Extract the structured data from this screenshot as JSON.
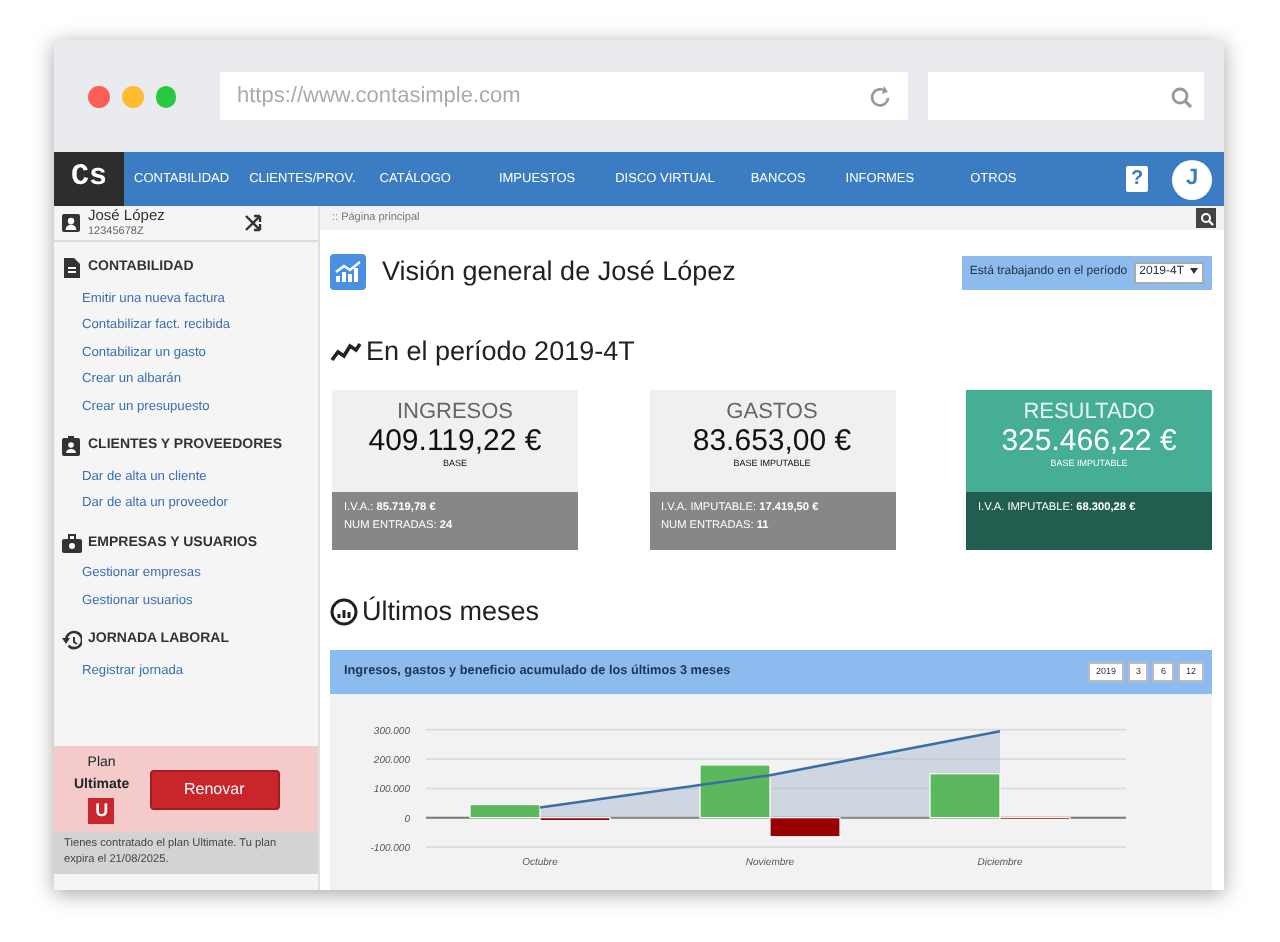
{
  "browser": {
    "url": "https://www.contasimple.com"
  },
  "navbar": {
    "logo": "Cs",
    "items": [
      "CONTABILIDAD",
      "CLIENTES/PROV.",
      "CATÁLOGO",
      "IMPUESTOS",
      "DISCO VIRTUAL",
      "BANCOS",
      "INFORMES",
      "OTROS"
    ],
    "help": "?",
    "avatar": "J"
  },
  "sidebar": {
    "user": {
      "name": "José López",
      "id": "12345678Z"
    },
    "sections": [
      {
        "title": "CONTABILIDAD",
        "links": [
          "Emitir una nueva factura",
          "Contabilizar fact. recibida",
          "Contabilizar un gasto",
          "Crear un albarán",
          "Crear un presupuesto"
        ]
      },
      {
        "title": "CLIENTES Y PROVEEDORES",
        "links": [
          "Dar de alta un cliente",
          "Dar de alta un proveedor"
        ]
      },
      {
        "title": "EMPRESAS Y USUARIOS",
        "links": [
          "Gestionar empresas",
          "Gestionar usuarios"
        ]
      },
      {
        "title": "JORNADA LABORAL",
        "links": [
          "Registrar jornada"
        ]
      }
    ],
    "plan": {
      "label": "Plan",
      "name": "Ultimate",
      "badge": "U",
      "button": "Renovar",
      "note": "Tienes contratado el plan Ultimate. Tu plan expira el 21/08/2025."
    }
  },
  "breadcrumb": ":: Página principal",
  "page": {
    "title": "Visión general de José López",
    "period": {
      "label": "Está trabajando en el período",
      "value": "2019-4T"
    }
  },
  "period_heading": "En el período 2019-4T",
  "cards": [
    {
      "kind": "neutral",
      "title": "INGRESOS",
      "amount": "409.119,22 €",
      "caption": "BASE",
      "details": [
        {
          "label": "I.V.A.:",
          "value": "85.719,78 €"
        },
        {
          "label": "NUM ENTRADAS:",
          "value": "24"
        }
      ]
    },
    {
      "kind": "neutral",
      "title": "GASTOS",
      "amount": "83.653,00 €",
      "caption": "BASE IMPUTABLE",
      "details": [
        {
          "label": "I.V.A. IMPUTABLE:",
          "value": "17.419,50 €"
        },
        {
          "label": "NUM ENTRADAS:",
          "value": "11"
        }
      ]
    },
    {
      "kind": "result",
      "title": "RESULTADO",
      "amount": "325.466,22 €",
      "caption": "BASE IMPUTABLE",
      "details": [
        {
          "label": "I.V.A. IMPUTABLE:",
          "value": "68.300,28 €"
        }
      ]
    }
  ],
  "recent": {
    "heading": "Últimos meses",
    "panel": {
      "title": "Ingresos, gastos y beneficio acumulado de los últimos 3 meses",
      "ranges": [
        "2019",
        "3",
        "6",
        "12"
      ],
      "chart_data": {
        "type": "bar",
        "categories": [
          "Octubre",
          "Noviembre",
          "Diciembre"
        ],
        "ylim": [
          -100000,
          300000
        ],
        "yticks": [
          {
            "value": -100000,
            "label": "-100.000"
          },
          {
            "value": 0,
            "label": "0"
          },
          {
            "value": 100000,
            "label": "100.000"
          },
          {
            "value": 200000,
            "label": "200.000"
          },
          {
            "value": 300000,
            "label": "300.000"
          }
        ],
        "series": [
          {
            "color": "#5cb85c",
            "values": [
              45000,
              180000,
              150000
            ]
          },
          {
            "color": "#990000",
            "values": [
              -10000,
              -65000,
              -2000
            ]
          },
          {
            "type": "area",
            "color": "#3a6ea5",
            "values": [
              35000,
              145000,
              295000
            ]
          }
        ],
        "stacked": false
      }
    }
  }
}
